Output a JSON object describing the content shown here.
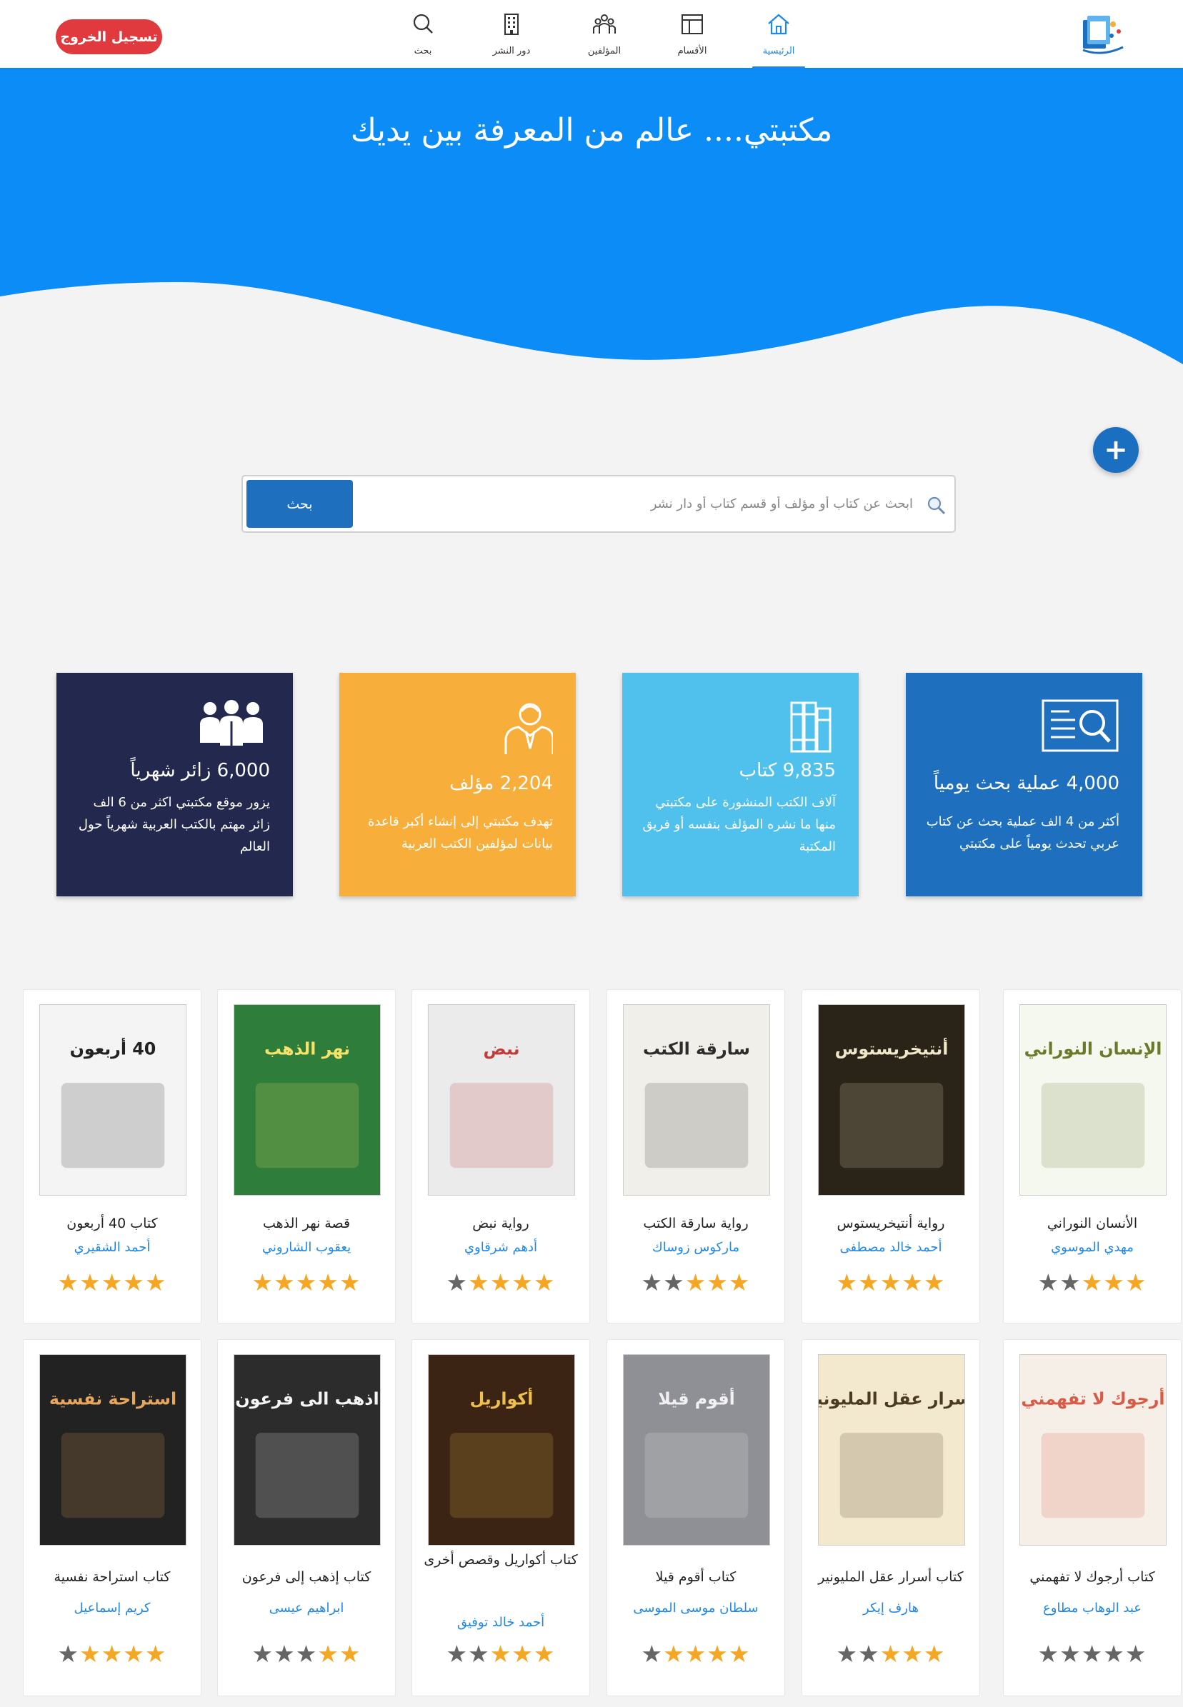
{
  "header": {
    "logout_label": "تسجيل الخروج",
    "nav": [
      {
        "label": "بحث",
        "icon": "search-icon"
      },
      {
        "label": "دور النشر",
        "icon": "building-icon"
      },
      {
        "label": "المؤلفين",
        "icon": "people-icon"
      },
      {
        "label": "الأقسام",
        "icon": "layout-icon"
      },
      {
        "label": "الرئيسية",
        "icon": "home-icon",
        "active": true
      }
    ]
  },
  "hero": {
    "title": "مكتبتي.... عالم من المعرفة بين يديك",
    "color": "#0b8cf6"
  },
  "search": {
    "placeholder": "ابحث عن كتاب أو مؤلف أو قسم كتاب أو دار نشر",
    "button_label": "بحث"
  },
  "stats": [
    {
      "number": "4,000 عملية بحث يومياً",
      "description": "أكثر من 4 الف عملية بحث عن كتاب عربي تحدث يومياً على مكتبتي",
      "icon": "search-document-icon",
      "color": "#1f6fbf"
    },
    {
      "number": "9,835 كتاب",
      "description": "آلاف الكتب المنشورة على مكتبتي منها ما نشره المؤلف بنفسه أو فريق المكتبة",
      "icon": "books-icon",
      "color": "#4fc1ec"
    },
    {
      "number": "2,204 مؤلف",
      "description": "تهدف مكتبتي إلى إنشاء أكبر قاعدة بيانات لمؤلفين الكتب العربية",
      "icon": "author-icon",
      "color": "#f7ae3a"
    },
    {
      "number": "6,000 زائر شهرياً",
      "description": "يزور موقع مكتبتي اكثر من 6 الف زائر مهتم بالكتب العربية شهرياً حول العالم",
      "icon": "visitors-icon",
      "color": "#23284f"
    }
  ],
  "books": [
    {
      "title": "الأنسان النوراني",
      "author": "مهدي الموسوي",
      "rating": 3
    },
    {
      "title": "رواية أنتيخريستوس",
      "author": "أحمد خالد مصطفى",
      "rating": 5
    },
    {
      "title": "رواية سارقة الكتب",
      "author": "ماركوس زوساك",
      "rating": 3
    },
    {
      "title": "رواية نبض",
      "author": "أدهم شرقاوي",
      "rating": 4
    },
    {
      "title": "قصة نهر الذهب",
      "author": "يعقوب الشاروني",
      "rating": 5
    },
    {
      "title": "كتاب 40 أربعون",
      "author": "أحمد الشقيري",
      "rating": 5
    },
    {
      "title": "كتاب أرجوك لا تفهمني",
      "author": "عبد الوهاب مطاوع",
      "rating": 0
    },
    {
      "title": "كتاب أسرار عقل المليونير",
      "author": "هارف إيكر",
      "rating": 3
    },
    {
      "title": "كتاب أقوم قيلا",
      "author": "سلطان موسى الموسى",
      "rating": 4
    },
    {
      "title": "كتاب أكواريل وقصص أخرى",
      "author": "أحمد خالد توفيق",
      "rating": 3
    },
    {
      "title": "كتاب إذهب إلى فرعون",
      "author": "ابراهيم عيسى",
      "rating": 2
    },
    {
      "title": "كتاب استراحة نفسية",
      "author": "كريم إسماعيل",
      "rating": 4
    }
  ],
  "covers": [
    {
      "text": "الإنسان النوراني",
      "bg": "#f4f8ef",
      "fg": "#6b7a2a"
    },
    {
      "text": "أنتيخريستوس",
      "bg": "#2a2418",
      "fg": "#f0e6c8"
    },
    {
      "text": "سارقة الكتب",
      "bg": "#f1efe9",
      "fg": "#2d2d2d"
    },
    {
      "text": "نبض",
      "bg": "#ebebeb",
      "fg": "#c33a3a"
    },
    {
      "text": "نهر الذهب",
      "bg": "#2f7d3a",
      "fg": "#f7e26b"
    },
    {
      "text": "40 أربعون",
      "bg": "#f4f4f4",
      "fg": "#222222"
    },
    {
      "text": "أرجوك لا تفهمني",
      "bg": "#f6efe7",
      "fg": "#d75b47"
    },
    {
      "text": "أسرار عقل المليونير",
      "bg": "#f3e9cf",
      "fg": "#4a3a22"
    },
    {
      "text": "أقوم قيلا",
      "bg": "#8f9095",
      "fg": "#f1f1f1"
    },
    {
      "text": "أكواريل",
      "bg": "#3b2414",
      "fg": "#f0c04d"
    },
    {
      "text": "اذهب الى فرعون",
      "bg": "#2c2c2c",
      "fg": "#f5f5f5"
    },
    {
      "text": "استراحة نفسية",
      "bg": "#222222",
      "fg": "#e7a65d"
    }
  ]
}
